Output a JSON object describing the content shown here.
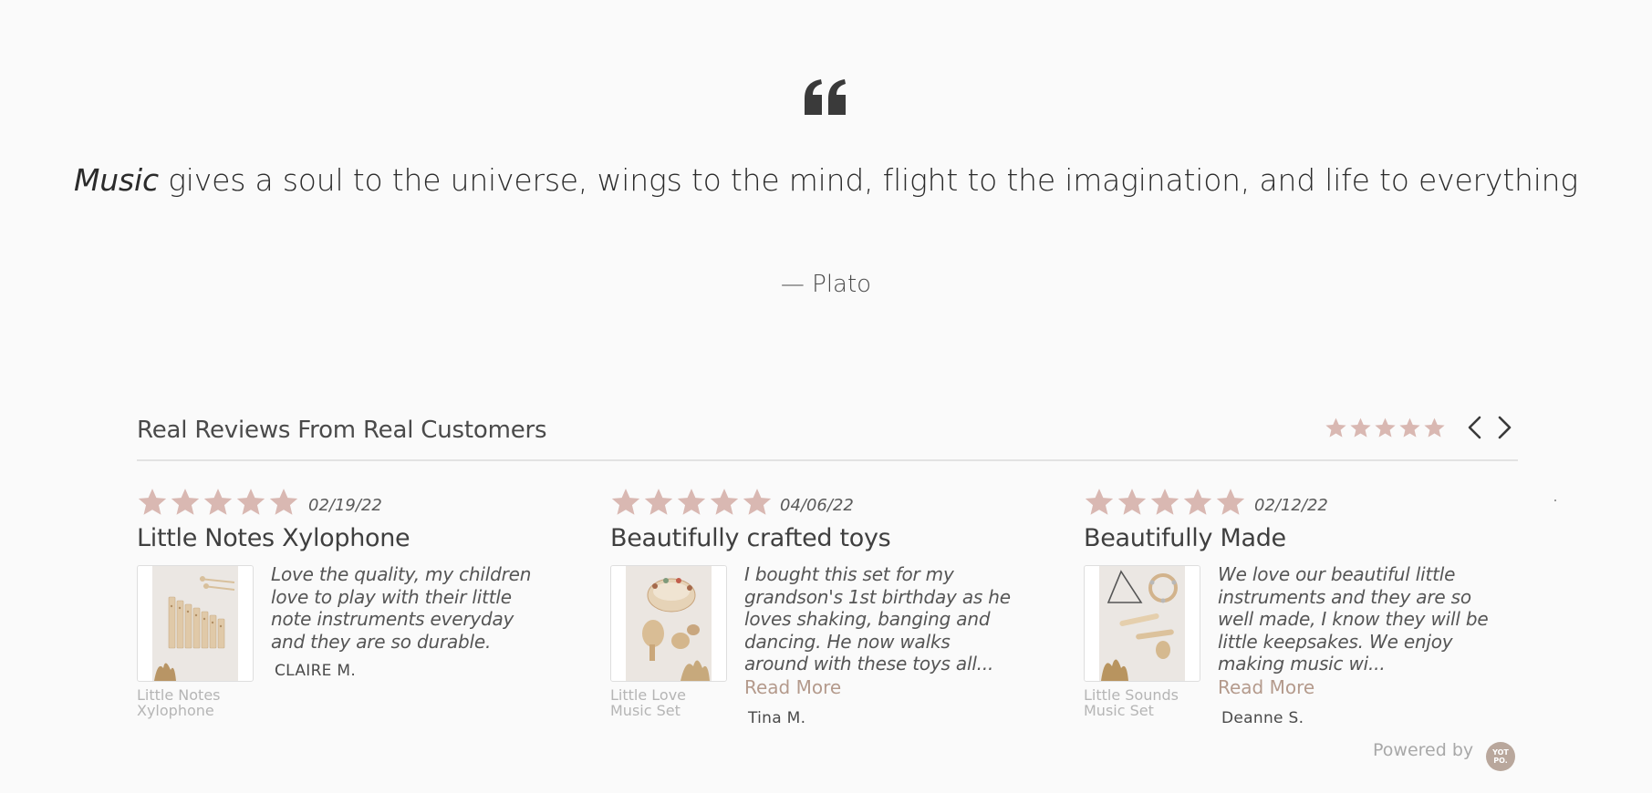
{
  "quote": {
    "emphasis": "Music",
    "text": " gives a soul to the universe, wings to the mind, flight to the imagination, and life to everything",
    "author": "— Plato"
  },
  "reviews_section": {
    "title": "Real Reviews From Real Customers",
    "overall_rating": 5,
    "star_color": "#d9b8b2"
  },
  "reviews": [
    {
      "rating": 5,
      "date": "02/19/22",
      "title": "Little Notes Xylophone",
      "body": "Love the quality, my children love to play with their little note instruments everyday and they are so durable.",
      "reviewer": "CLAIRE M.",
      "product": "Little Notes Xylophone",
      "read_more": ""
    },
    {
      "rating": 5,
      "date": "04/06/22",
      "title": "Beautifully crafted toys",
      "body": "I bought this set for my grandson's 1st birthday as he loves shaking, banging and dancing. He now walks around with these toys all...",
      "reviewer": "Tina M.",
      "product": "Little Love Music Set",
      "read_more": "Read More"
    },
    {
      "rating": 5,
      "date": "02/12/22",
      "title": "Beautifully Made",
      "body": "We love our beautiful little instruments and they are so well made, I know they will be little keepsakes. We enjoy making music wi...",
      "reviewer": "Deanne S.",
      "product": "Little Sounds Music Set",
      "read_more": "Read More"
    }
  ],
  "footer": {
    "powered_by": "Powered by",
    "logo_text": "YOT PO."
  }
}
